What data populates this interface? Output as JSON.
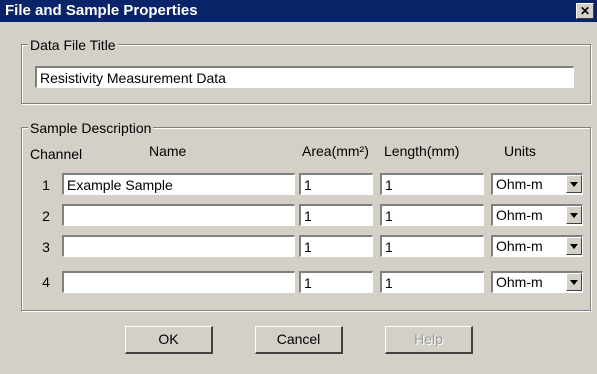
{
  "window": {
    "title": "File and Sample Properties",
    "close_glyph": "✕"
  },
  "data_file": {
    "group_label": "Data File Title",
    "title_value": "Resistivity Measurement Data"
  },
  "sample": {
    "group_label": "Sample Description",
    "headers": {
      "channel": "Channel",
      "name": "Name",
      "area": "Area(mm²)",
      "length": "Length(mm)",
      "units": "Units"
    },
    "rows": [
      {
        "channel": "1",
        "name": "Example Sample",
        "area": "1",
        "length": "1",
        "units": "Ohm-m"
      },
      {
        "channel": "2",
        "name": "",
        "area": "1",
        "length": "1",
        "units": "Ohm-m"
      },
      {
        "channel": "3",
        "name": "",
        "area": "1",
        "length": "1",
        "units": "Ohm-m"
      },
      {
        "channel": "4",
        "name": "",
        "area": "1",
        "length": "1",
        "units": "Ohm-m"
      }
    ]
  },
  "buttons": {
    "ok": "OK",
    "cancel": "Cancel",
    "help": "Help"
  }
}
